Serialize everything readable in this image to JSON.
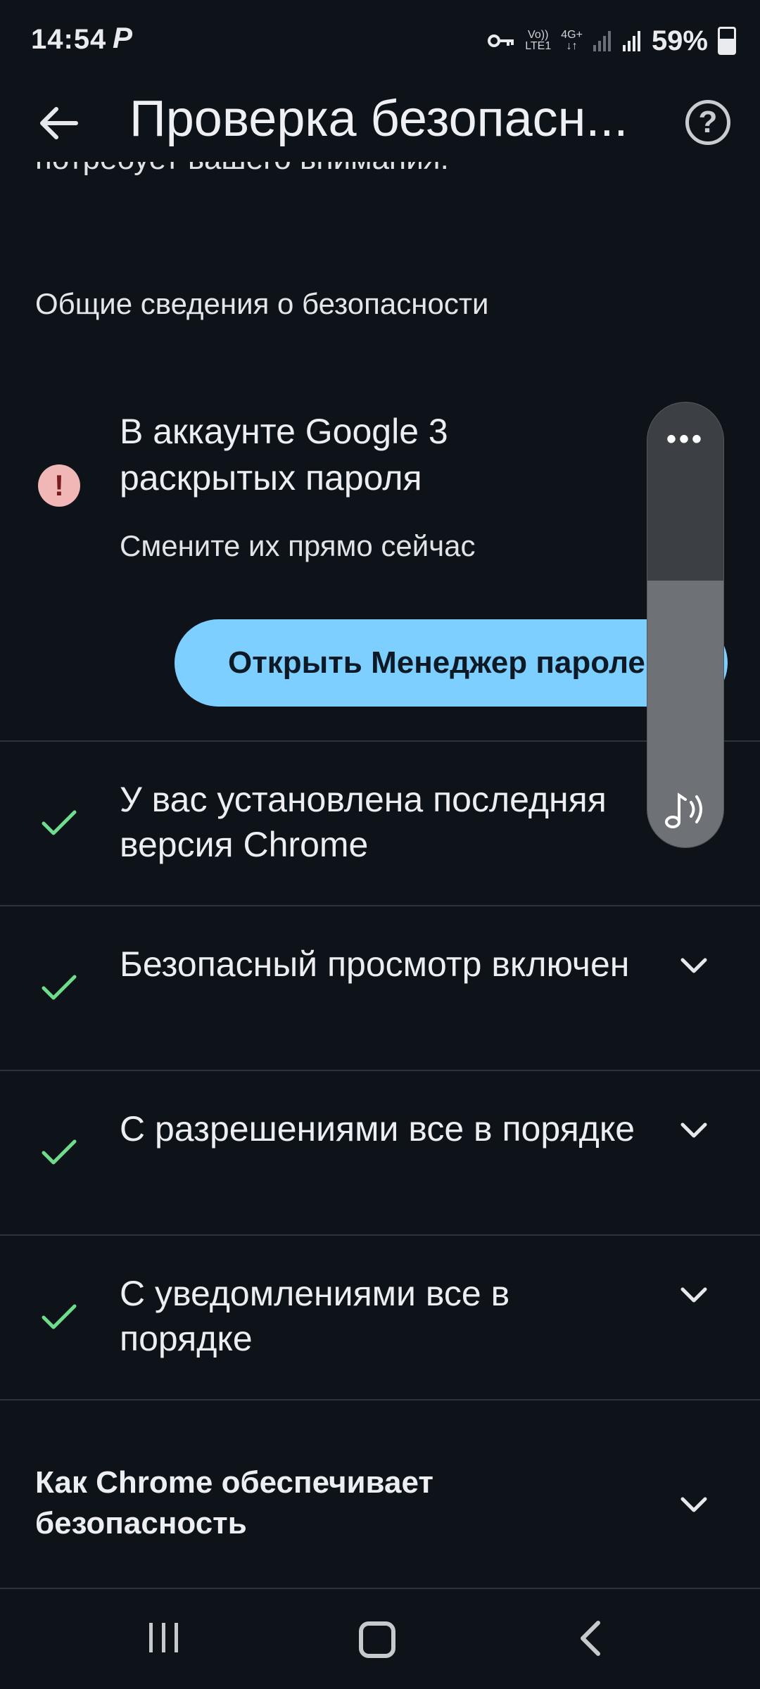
{
  "status_bar": {
    "time": "14:54",
    "carrier_glyph": "P",
    "volte": "Vo))",
    "lte": "LTE1",
    "network": "4G+",
    "battery_percent": "59%",
    "battery_level": 0.59,
    "icons": [
      "key-icon",
      "volte-icon",
      "signal-icon",
      "signal-icon",
      "battery-icon"
    ]
  },
  "app_bar": {
    "title": "Проверка безопасн...",
    "icons": [
      "back-arrow-icon",
      "help-icon"
    ]
  },
  "content": {
    "cut_text": "потребует вашего внимания.",
    "section_header": "Общие сведения о безопасности",
    "password_warning": {
      "title": "В аккаунте Google 3 раскрытых пароля",
      "subtitle": "Смените их прямо сейчас",
      "button_label": "Открыть Менеджер паролей",
      "icon": "exclamation-icon",
      "icon_bg": "#f1b7b7",
      "button_color": "#7ccfff"
    },
    "check_rows": [
      {
        "text": "У вас установлена последняя версия Chrome",
        "expandable": false
      },
      {
        "text": "Безопасный просмотр включен",
        "expandable": true
      },
      {
        "text": "С разрешениями все в порядке",
        "expandable": true
      },
      {
        "text": "С уведомлениями все в порядке",
        "expandable": true
      }
    ],
    "how_chrome": "Как Chrome обеспечивает безопасность",
    "check_color": "#6fdc8c"
  },
  "volume_overlay": {
    "dots": "•••",
    "level": 0.6,
    "icon": "music-volume-icon"
  },
  "nav_bar": {
    "icons": [
      "recents-icon",
      "home-icon",
      "back-icon"
    ]
  }
}
